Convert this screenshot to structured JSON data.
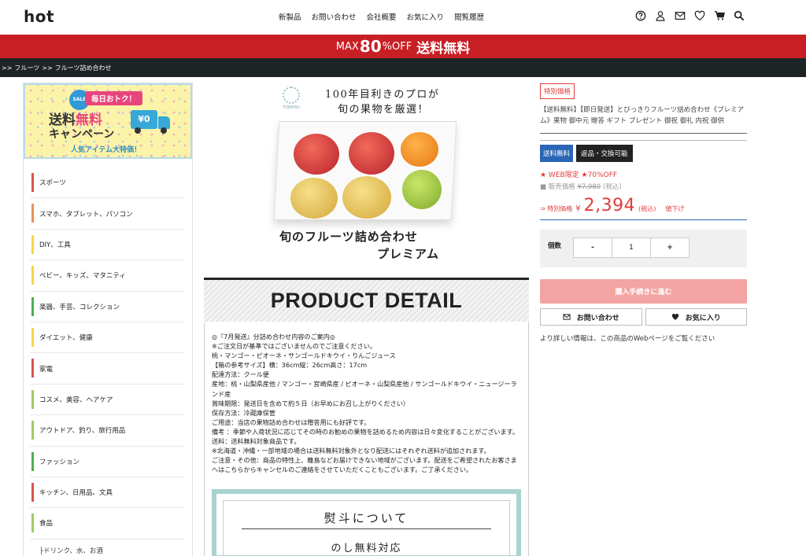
{
  "header": {
    "logo": "hot",
    "nav": [
      "新製品",
      "お問い合わせ",
      "会社概要",
      "お気に入り",
      "閲覧履歴"
    ],
    "icons": [
      "help-icon",
      "user-icon",
      "mail-icon",
      "heart-icon",
      "cart-icon",
      "search-icon"
    ]
  },
  "promo": {
    "part1": "MAX",
    "part2": "80",
    "part3": "%OFF",
    "part4": "送料無料"
  },
  "breadcrumb": {
    "arrow1": ">>",
    "item1": "フルーツ",
    "arrow2": ">>",
    "item2": "フルーツ詰め合わせ"
  },
  "sidebar": {
    "banner": {
      "sale": "SALE",
      "tag": "毎日おトク！",
      "line1a": "送料",
      "line1b": "無料",
      "line2": "キャンペーン",
      "truck": "¥0",
      "line3": "人気アイテム大特価！"
    },
    "categories": [
      {
        "label": "スポーツ",
        "color": "#d9534f"
      },
      {
        "label": "スマホ、タブレット、パソコン",
        "color": "#e8935a"
      },
      {
        "label": "DIY、工具",
        "color": "#f5d547"
      },
      {
        "label": "ベビー、キッズ、マタニティ",
        "color": "#f5d547"
      },
      {
        "label": "楽器、手芸、コレクション",
        "color": "#4caf50"
      },
      {
        "label": "ダイエット、健康",
        "color": "#f5d547"
      },
      {
        "label": "家電",
        "color": "#d9534f"
      },
      {
        "label": "コスメ、美容、ヘアケア",
        "color": "#9ccc65"
      },
      {
        "label": "アウトドア、釣り、旅行用品",
        "color": "#9ccc65"
      },
      {
        "label": "ファッション",
        "color": "#4caf50"
      },
      {
        "label": "キッチン、日用品、文具",
        "color": "#d9534f"
      },
      {
        "label": "食品",
        "color": "#9ccc65"
      }
    ],
    "subcategory": "├ドリンク、水、お酒"
  },
  "product_image": {
    "logo_text": "TOBIFRU",
    "tagline1": "100年目利きのプロが",
    "tagline2": "旬の果物を厳選！",
    "title1": "旬のフルーツ詰め合わせ",
    "title2": "プレミアム"
  },
  "detail": {
    "heading": "PRODUCT DETAIL",
    "lines": [
      "◎『7月発送』分詰め合わせ内容のご案内◎",
      "※ご注文日が基準ではございませんのでご注意ください。",
      "桃・マンゴー・ピオーネ・サンゴールドキウイ・りんごジュース",
      "【箱の参考サイズ】横：36cm縦：26cm高さ：17cm",
      "配達方法：クール便",
      "産地：桃・山梨県産他 / マンゴー・宮崎県産 / ピオーネ・山梨県産他 / サンゴールドキウイ・ニュージーランド産",
      "賞味期限：発送日を含めて約５日（お早めにお召し上がりください）",
      "保存方法：冷蔵庫保管",
      "ご用途：当店の果物詰め合わせは贈答用にも好評です。",
      "備考 ：季節や入荷状況に応じてその時のお勧めの果物を詰めるため内容は日々変化することがございます。",
      "送料：送料無料対象商品です。",
      "※北海道・沖縄・一部地域の場合は送料無料対象外となり配送にはそれぞれ送料が追加されます。",
      "ご注意・その他：商品の特性上、離島などお届けできない地域がございます。配送をご希望されたお客さまへはこちらからキャンセルのご連絡をさせていただくこともございます。ご了承ください。"
    ],
    "noshi_title": "熨斗について",
    "noshi_sub": "のし無料対応"
  },
  "right": {
    "badge": "特別価格",
    "title": "【送料無料】【即日発送】とびっきりフルーツ詰め合わせ《プレミアム》果物 御中元 贈答 ギフト プレゼント 御祝 御礼 内祝 御供",
    "badge_shipping": "送料無料",
    "badge_return": "返品・交換可能",
    "web_limit": "★ WEB限定 ★70%OFF",
    "regular_label": "販売価格",
    "regular_price": "¥7,980",
    "regular_tax": "(税込)",
    "special_label": "⇒ 特別価格",
    "special_yen": "¥",
    "special_price": "2,394",
    "special_tax": "(税込)",
    "price_drop": "値下げ",
    "qty_label": "個数",
    "qty_minus": "-",
    "qty_value": "1",
    "qty_plus": "+",
    "buy_label": "購入手続きに進む",
    "contact_label": "お問い合わせ",
    "favorite_label": "お気に入り",
    "more_info": "より詳しい情報は、この商品のWebページをご覧ください"
  }
}
